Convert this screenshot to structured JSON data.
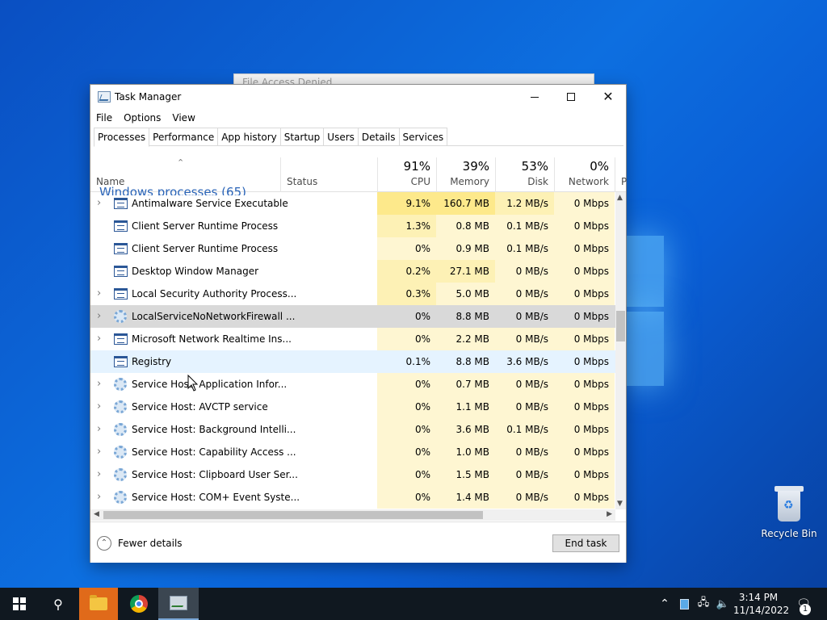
{
  "background_window": {
    "title": "File Access Denied"
  },
  "window": {
    "title": "Task Manager",
    "controls": {
      "minimize": "—",
      "maximize": "☐",
      "close": "✕"
    }
  },
  "menu": [
    "File",
    "Options",
    "View"
  ],
  "tabs": [
    "Processes",
    "Performance",
    "App history",
    "Startup",
    "Users",
    "Details",
    "Services"
  ],
  "active_tab": "Processes",
  "columns": {
    "name": "Name",
    "status": "Status",
    "cpu": {
      "percent": "91%",
      "label": "CPU"
    },
    "memory": {
      "percent": "39%",
      "label": "Memory"
    },
    "disk": {
      "percent": "53%",
      "label": "Disk"
    },
    "network": {
      "percent": "0%",
      "label": "Network"
    },
    "power_peek": "P"
  },
  "group_label": "Windows processes (65)",
  "processes": [
    {
      "name": "Antimalware Service Executable",
      "cpu": "9.1%",
      "memory": "160.7 MB",
      "disk": "1.2 MB/s",
      "network": "0 Mbps",
      "expandable": true,
      "icon": "window"
    },
    {
      "name": "Client Server Runtime Process",
      "cpu": "1.3%",
      "memory": "0.8 MB",
      "disk": "0.1 MB/s",
      "network": "0 Mbps",
      "expandable": false,
      "icon": "window"
    },
    {
      "name": "Client Server Runtime Process",
      "cpu": "0%",
      "memory": "0.9 MB",
      "disk": "0.1 MB/s",
      "network": "0 Mbps",
      "expandable": false,
      "icon": "window"
    },
    {
      "name": "Desktop Window Manager",
      "cpu": "0.2%",
      "memory": "27.1 MB",
      "disk": "0 MB/s",
      "network": "0 Mbps",
      "expandable": false,
      "icon": "window"
    },
    {
      "name": "Local Security Authority Process...",
      "cpu": "0.3%",
      "memory": "5.0 MB",
      "disk": "0 MB/s",
      "network": "0 Mbps",
      "expandable": true,
      "icon": "window"
    },
    {
      "name": "LocalServiceNoNetworkFirewall ...",
      "cpu": "0%",
      "memory": "8.8 MB",
      "disk": "0 MB/s",
      "network": "0 Mbps",
      "expandable": true,
      "icon": "gear"
    },
    {
      "name": "Microsoft Network Realtime Ins...",
      "cpu": "0%",
      "memory": "2.2 MB",
      "disk": "0 MB/s",
      "network": "0 Mbps",
      "expandable": true,
      "icon": "window"
    },
    {
      "name": "Registry",
      "cpu": "0.1%",
      "memory": "8.8 MB",
      "disk": "3.6 MB/s",
      "network": "0 Mbps",
      "expandable": false,
      "icon": "window"
    },
    {
      "name": "Service Host: Application Infor...",
      "cpu": "0%",
      "memory": "0.7 MB",
      "disk": "0 MB/s",
      "network": "0 Mbps",
      "expandable": true,
      "icon": "gear"
    },
    {
      "name": "Service Host: AVCTP service",
      "cpu": "0%",
      "memory": "1.1 MB",
      "disk": "0 MB/s",
      "network": "0 Mbps",
      "expandable": true,
      "icon": "gear"
    },
    {
      "name": "Service Host: Background Intelli...",
      "cpu": "0%",
      "memory": "3.6 MB",
      "disk": "0.1 MB/s",
      "network": "0 Mbps",
      "expandable": true,
      "icon": "gear"
    },
    {
      "name": "Service Host: Capability Access ...",
      "cpu": "0%",
      "memory": "1.0 MB",
      "disk": "0 MB/s",
      "network": "0 Mbps",
      "expandable": true,
      "icon": "gear"
    },
    {
      "name": "Service Host: Clipboard User Ser...",
      "cpu": "0%",
      "memory": "1.5 MB",
      "disk": "0 MB/s",
      "network": "0 Mbps",
      "expandable": true,
      "icon": "gear"
    },
    {
      "name": "Service Host: COM+ Event Syste...",
      "cpu": "0%",
      "memory": "1.4 MB",
      "disk": "0 MB/s",
      "network": "0 Mbps",
      "expandable": true,
      "icon": "gear"
    }
  ],
  "selected_row": 5,
  "hover_row": 7,
  "footer": {
    "fewer_details": "Fewer details",
    "end_task": "End task"
  },
  "desktop": {
    "recycle_bin": "Recycle Bin"
  },
  "taskbar": {
    "time": "3:14 PM",
    "date": "11/14/2022",
    "notifications": "1"
  },
  "colors": {
    "heat_high": "#fde98b",
    "heat_mid": "#fdf1b5",
    "heat_low": "#fef6d2",
    "accent": "#2b5797",
    "desktop_blue": "#0d6fe0"
  }
}
